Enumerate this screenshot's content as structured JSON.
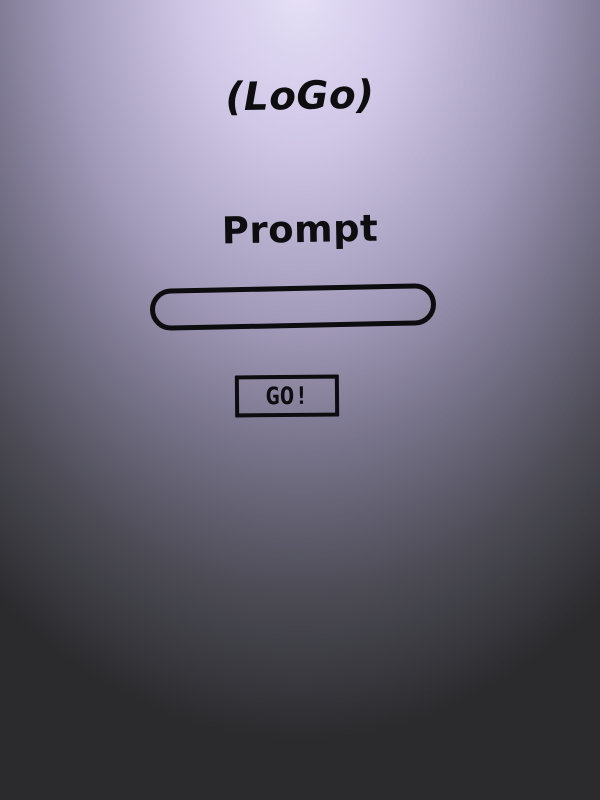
{
  "logo": {
    "text": "(LoGo)"
  },
  "prompt": {
    "label": "Prompt",
    "value": "",
    "placeholder": ""
  },
  "actions": {
    "go_label": "GO!"
  },
  "colors": {
    "ink": "#0d0d10",
    "background_top": "#e7e1f7",
    "background_bottom": "#2b2b2e"
  }
}
